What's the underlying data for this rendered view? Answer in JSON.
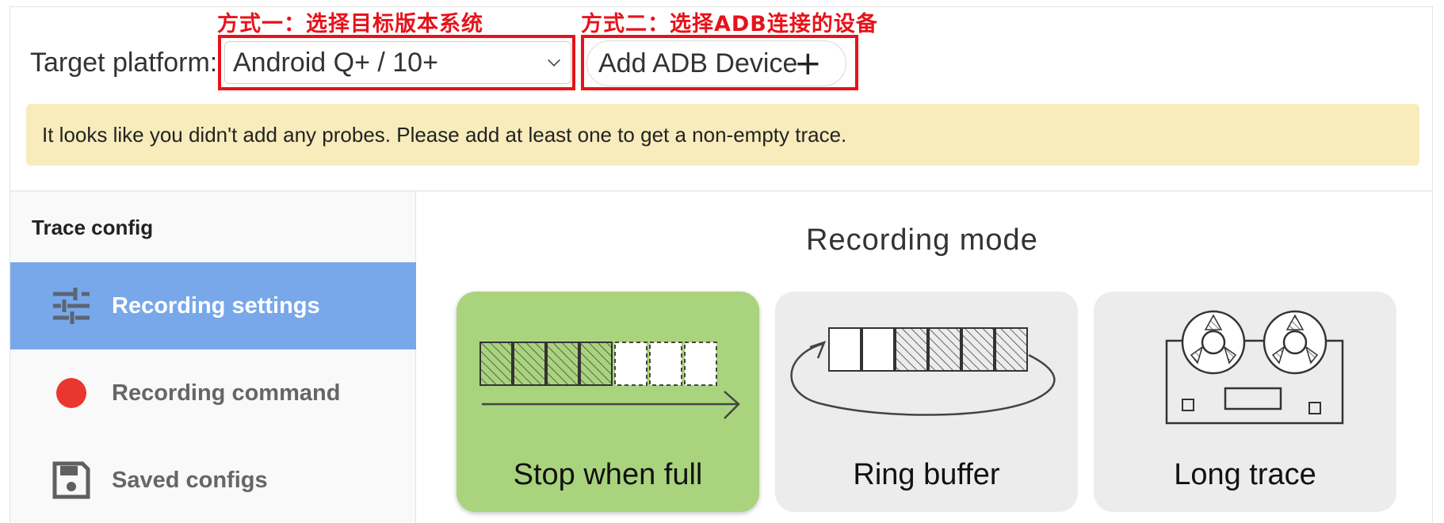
{
  "annotations": {
    "method_one": "方式一：选择目标版本系统",
    "method_two": "方式二：选择ADB连接的设备"
  },
  "header": {
    "target_platform_label": "Target platform:",
    "platform_selected": "Android Q+ / 10+",
    "add_adb_label": "Add ADB Device"
  },
  "warning": {
    "text": "It looks like you didn't add any probes. Please add at least one to get a non-empty trace."
  },
  "sidebar": {
    "title": "Trace config",
    "items": [
      {
        "label": "Recording settings",
        "icon": "sliders-icon",
        "active": true
      },
      {
        "label": "Recording command",
        "icon": "record-dot-icon",
        "active": false
      },
      {
        "label": "Saved configs",
        "icon": "floppy-disk-icon",
        "active": false
      }
    ]
  },
  "main": {
    "title": "Recording mode",
    "modes": [
      {
        "label": "Stop when full",
        "selected": true
      },
      {
        "label": "Ring buffer",
        "selected": false
      },
      {
        "label": "Long trace",
        "selected": false
      }
    ]
  },
  "colors": {
    "annotation": "#e8121a",
    "active_nav": "#78a8ea",
    "selected_card": "#a9d47d",
    "warning_bg": "#f8ecbc",
    "record_dot": "#e9372f"
  }
}
